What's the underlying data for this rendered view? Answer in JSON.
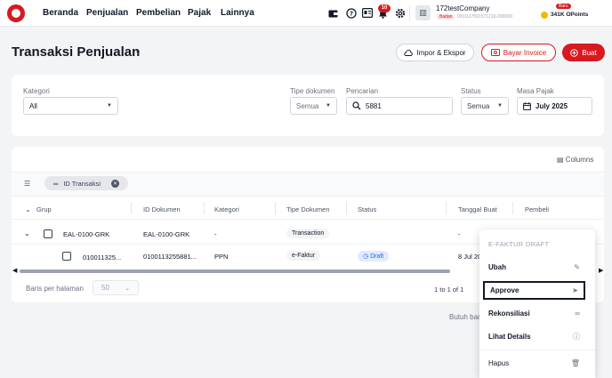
{
  "nav": {
    "items": [
      "Beranda",
      "Penjualan",
      "Pembelian",
      "Pajak",
      "Lainnya"
    ],
    "notification_count": "10",
    "company": {
      "name": "172testCompany",
      "tag": "Badan",
      "npwp": "0911117591571210-000000"
    },
    "points": {
      "new_label": "Baru",
      "value": "341K OPoints"
    }
  },
  "header": {
    "title": "Transaksi Penjualan",
    "impor_label": "Impor & Ekspor",
    "bayar_label": "Bayar Invoice",
    "buat_label": "Buat"
  },
  "filters": {
    "kategori": {
      "label": "Kategori",
      "value": "All"
    },
    "tipe": {
      "label": "Tipe dokumen",
      "value": "Semua"
    },
    "pencarian": {
      "label": "Pencarian",
      "value": "5881"
    },
    "status": {
      "label": "Status",
      "value": "Semua"
    },
    "masa": {
      "label": "Masa Pajak",
      "value": "July 2025"
    }
  },
  "table": {
    "columns_label": "Columns",
    "group_chip": "ID Transaksi",
    "headers": [
      "Grup",
      "ID Dokumen",
      "Kategori",
      "Tipe Dokumen",
      "Status",
      "Tanggal Buat",
      "Pembeli"
    ],
    "group_row": {
      "grup": "EAL-0100-GRK",
      "id_dokumen": "EAL-0100-GRK",
      "kategori": "-",
      "tipe": "Transaction",
      "tanggal": "-"
    },
    "detail_row": {
      "grup": "010011325...",
      "id_dokumen": "0100113255881...",
      "kategori": "PPN",
      "tipe": "e-Faktur",
      "status": "Draft",
      "tanggal": "8 Jul 20"
    },
    "baris_label": "Baris per halaman",
    "baris_value": "50",
    "pager": "1 to 1 of 1"
  },
  "footer_hint": "Butuh ban",
  "menu": {
    "heading": "E-FAKTUR DRAFT",
    "items": [
      "Ubah",
      "Approve",
      "Rekonsiliasi",
      "Lihat Details",
      "Hapus"
    ]
  }
}
